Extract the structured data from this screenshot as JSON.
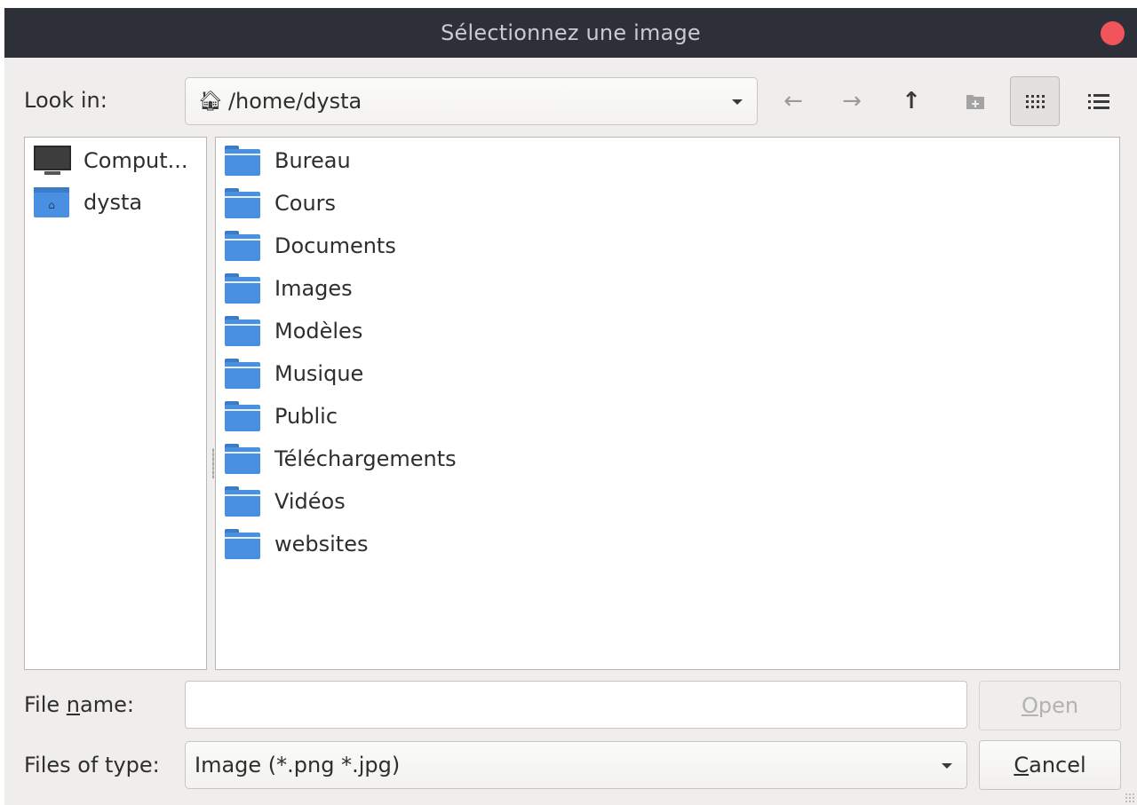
{
  "window": {
    "title": "Sélectionnez une image"
  },
  "look_in": {
    "label": "Look in:",
    "path": "/home/dysta",
    "path_icon": "home-icon"
  },
  "toolbar": {
    "back_icon": "arrow-left-icon",
    "forward_icon": "arrow-right-icon",
    "up_icon": "arrow-up-icon",
    "new_folder_icon": "new-folder-icon",
    "list_mode_icon": "icon-grid-icon",
    "detail_mode_icon": "detail-list-icon"
  },
  "sidebar": {
    "items": [
      {
        "label": "Comput...",
        "icon": "computer-icon"
      },
      {
        "label": "dysta",
        "icon": "home-folder-icon"
      }
    ]
  },
  "files": [
    {
      "name": "Bureau"
    },
    {
      "name": "Cours"
    },
    {
      "name": "Documents"
    },
    {
      "name": "Images"
    },
    {
      "name": "Modèles"
    },
    {
      "name": "Musique"
    },
    {
      "name": "Public"
    },
    {
      "name": "Téléchargements"
    },
    {
      "name": "Vidéos"
    },
    {
      "name": "websites"
    }
  ],
  "file_name": {
    "label_pre": "File ",
    "label_mnemonic": "n",
    "label_post": "ame:",
    "value": ""
  },
  "file_type": {
    "label": "Files of type:",
    "selected": "Image (*.png *.jpg)"
  },
  "buttons": {
    "open_mnemonic": "O",
    "open_rest": "pen",
    "cancel_mnemonic": "C",
    "cancel_rest": "ancel"
  },
  "colors": {
    "titlebar": "#2d3039",
    "close": "#f2545b",
    "folder": "#4a90e2",
    "dialog_bg": "#efeeec"
  }
}
